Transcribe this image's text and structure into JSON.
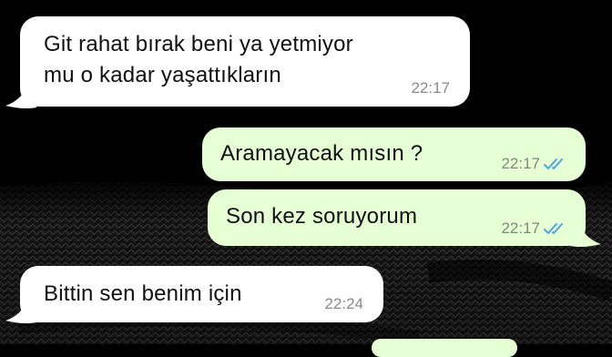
{
  "chat": {
    "theme": {
      "background": "#000000",
      "incoming_bubble": "#ffffff",
      "outgoing_bubble": "#e6ffd4",
      "read_receipt": "#4fa3e8",
      "timestamp": "#8a8a8e"
    },
    "messages": [
      {
        "direction": "incoming",
        "text": "Git rahat bırak beni ya yetmiyor\nmu o kadar yaşattıkların",
        "time": "22:17"
      },
      {
        "direction": "outgoing",
        "text": "Aramayacak mısın ?",
        "time": "22:17",
        "status_icon": "double-check-read-icon"
      },
      {
        "direction": "outgoing",
        "text": "Son kez soruyorum",
        "time": "22:17",
        "status_icon": "double-check-read-icon"
      },
      {
        "direction": "incoming",
        "text": "Bittin sen benim için",
        "time": "22:24"
      }
    ]
  }
}
